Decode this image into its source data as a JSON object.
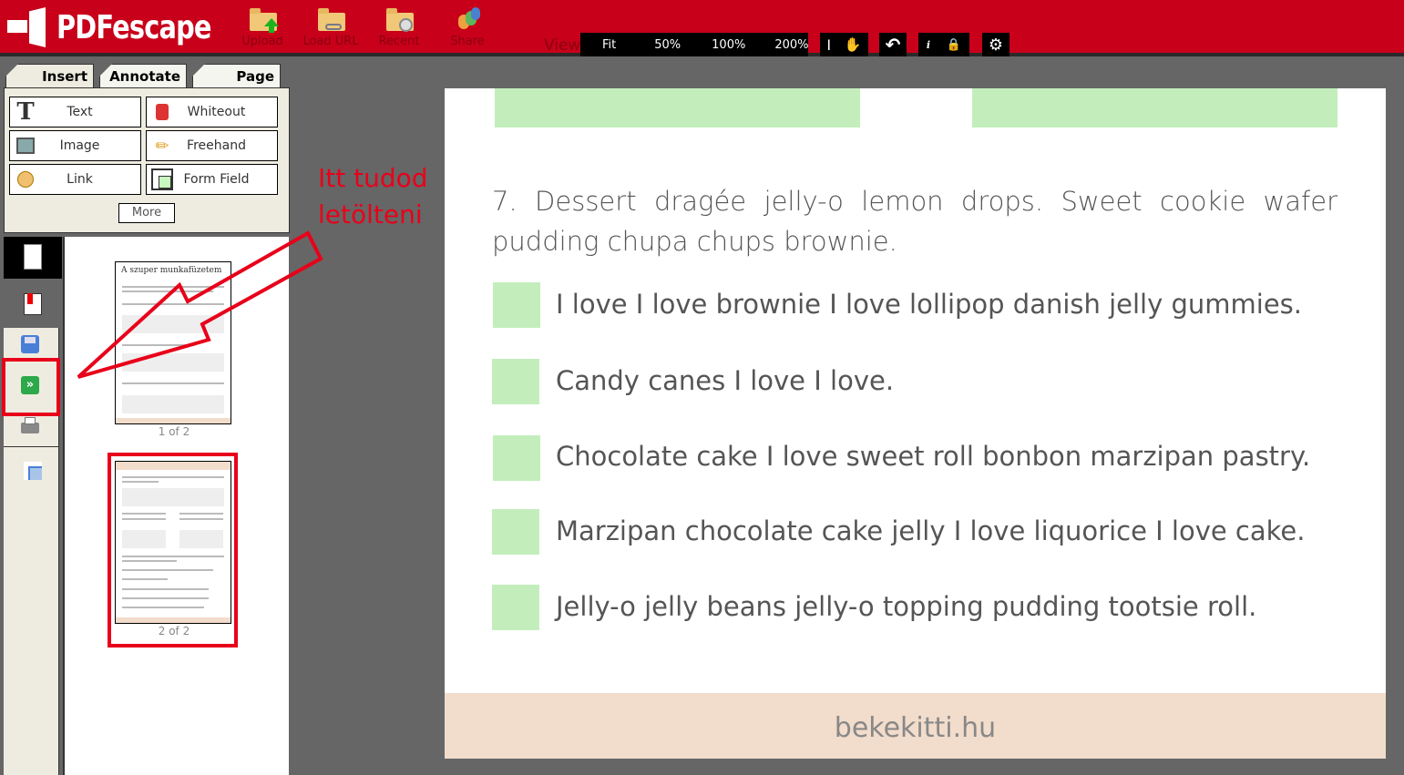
{
  "app": {
    "name": "PDFescape"
  },
  "toolbar": {
    "upload": "Upload",
    "load_url": "Load URL",
    "recent": "Recent",
    "share": "Share",
    "view_label": "View",
    "zoom": [
      "Fit",
      "50%",
      "100%",
      "200%"
    ]
  },
  "tabs": [
    "Insert",
    "Annotate",
    "Page"
  ],
  "insert_tools": [
    "Text",
    "Whiteout",
    "Image",
    "Freehand",
    "Link",
    "Form Field"
  ],
  "more_label": "More",
  "thumbnails": {
    "page1_title": "A szuper munkafüzetem",
    "labels": [
      "1 of 2",
      "2 of 2"
    ]
  },
  "annotation": {
    "line1": "Itt tudod",
    "line2": "letölteni",
    "color": "#e8001a"
  },
  "document": {
    "question": "7. Dessert dragée jelly-o lemon drops. Sweet cookie wafer pudding chupa chups brownie.",
    "options": [
      "I love I love brownie I love lollipop danish jelly gummies.",
      "Candy canes I love I love.",
      "Chocolate cake I love sweet roll bonbon marzipan pastry.",
      "Marzipan chocolate cake jelly I love liquorice I love cake.",
      "Jelly-o jelly beans jelly-o topping pudding tootsie roll."
    ],
    "footer": "bekekitti.hu"
  },
  "colors": {
    "brand": "#c8001a",
    "checkbox": "#c3eebc",
    "footer": "#f2dccb"
  }
}
